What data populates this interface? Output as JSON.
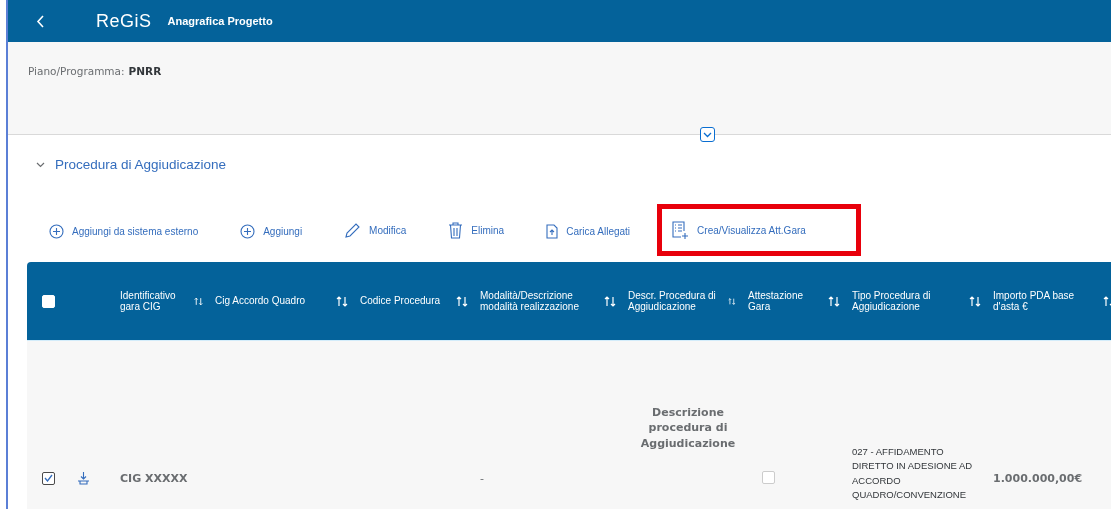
{
  "header": {
    "logo": "ReGiS",
    "title": "Anagrafica Progetto"
  },
  "info": {
    "label": "Piano/Programma:",
    "value": "PNRR"
  },
  "section": {
    "title": "Procedura di Aggiudicazione",
    "expanded": true
  },
  "toolbar": [
    {
      "kind": "add",
      "label": "Aggiungi da sistema esterno",
      "highlighted": false
    },
    {
      "kind": "add",
      "label": "Aggiungi",
      "highlighted": false
    },
    {
      "kind": "edit",
      "label": "Modifica",
      "highlighted": false
    },
    {
      "kind": "delete",
      "label": "Elimina",
      "highlighted": false
    },
    {
      "kind": "upload",
      "label": "Carica Allegati",
      "highlighted": false
    },
    {
      "kind": "list",
      "label": "Crea/Visualizza Att.Gara",
      "highlighted": true
    }
  ],
  "table": {
    "select_all": {
      "checked": false
    },
    "columns": [
      "Identificativo gara CIG",
      "Cig Accordo Quadro",
      "Codice Procedura",
      "Modalità/Descrizione modalità realizzazione",
      "Descr. Procedura di Aggiudicazione",
      "Attestazione Gara",
      "Tipo Procedura di Aggiudicazione",
      "Importo PDA base d'asta €"
    ],
    "rows": [
      {
        "checked": true,
        "cells": [
          {
            "kind": "text",
            "text": "CIG XXXXX"
          },
          {
            "kind": "text",
            "text": ""
          },
          {
            "kind": "text",
            "text": ""
          },
          {
            "kind": "text",
            "text": "-"
          },
          {
            "kind": "desc",
            "text": "Descrizione procedura di Aggiudicazione"
          },
          {
            "kind": "checkbox",
            "checked": false
          },
          {
            "kind": "small",
            "text": "027 - AFFIDAMENTO DIRETTO IN ADESIONE AD ACCORDO QUADRO/CONVENZIONE"
          },
          {
            "kind": "text",
            "text": "1.000.000,00€"
          }
        ]
      }
    ]
  }
}
